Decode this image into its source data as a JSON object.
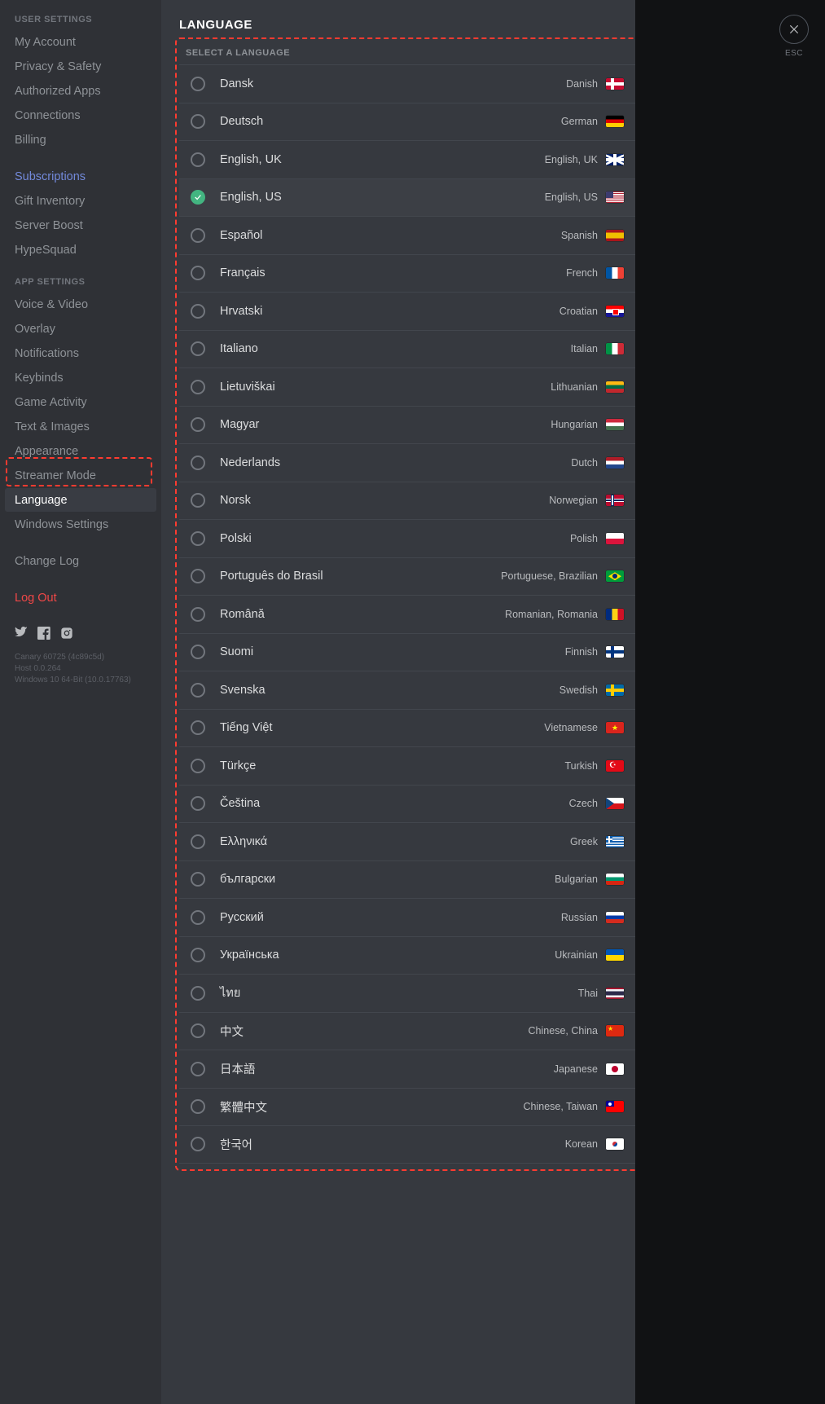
{
  "sidebar": {
    "user_settings_header": "USER SETTINGS",
    "user_items": [
      {
        "label": "My Account"
      },
      {
        "label": "Privacy & Safety"
      },
      {
        "label": "Authorized Apps"
      },
      {
        "label": "Connections"
      },
      {
        "label": "Billing"
      }
    ],
    "subs_item": "Subscriptions",
    "nitro_items": [
      {
        "label": "Gift Inventory"
      },
      {
        "label": "Server Boost"
      },
      {
        "label": "HypeSquad"
      }
    ],
    "app_settings_header": "APP SETTINGS",
    "app_items": [
      {
        "label": "Voice & Video"
      },
      {
        "label": "Overlay"
      },
      {
        "label": "Notifications"
      },
      {
        "label": "Keybinds"
      },
      {
        "label": "Game Activity"
      },
      {
        "label": "Text & Images"
      },
      {
        "label": "Appearance"
      },
      {
        "label": "Streamer Mode"
      },
      {
        "label": "Language",
        "selected": true
      },
      {
        "label": "Windows Settings"
      }
    ],
    "change_log": "Change Log",
    "logout": "Log Out",
    "build": {
      "line1": "Canary 60725 (4c89c5d)",
      "line2": "Host 0.0.264",
      "line3": "Windows 10 64-Bit (10.0.17763)"
    }
  },
  "main": {
    "title": "LANGUAGE",
    "panel_header": "SELECT A LANGUAGE",
    "languages": [
      {
        "native": "Dansk",
        "english": "Danish",
        "flag": "dk",
        "selected": false
      },
      {
        "native": "Deutsch",
        "english": "German",
        "flag": "de",
        "selected": false
      },
      {
        "native": "English, UK",
        "english": "English, UK",
        "flag": "gb",
        "selected": false
      },
      {
        "native": "English, US",
        "english": "English, US",
        "flag": "us",
        "selected": true
      },
      {
        "native": "Español",
        "english": "Spanish",
        "flag": "es",
        "selected": false
      },
      {
        "native": "Français",
        "english": "French",
        "flag": "fr",
        "selected": false
      },
      {
        "native": "Hrvatski",
        "english": "Croatian",
        "flag": "hr",
        "selected": false
      },
      {
        "native": "Italiano",
        "english": "Italian",
        "flag": "it",
        "selected": false
      },
      {
        "native": "Lietuviškai",
        "english": "Lithuanian",
        "flag": "lt",
        "selected": false
      },
      {
        "native": "Magyar",
        "english": "Hungarian",
        "flag": "hu",
        "selected": false
      },
      {
        "native": "Nederlands",
        "english": "Dutch",
        "flag": "nl",
        "selected": false
      },
      {
        "native": "Norsk",
        "english": "Norwegian",
        "flag": "no",
        "selected": false
      },
      {
        "native": "Polski",
        "english": "Polish",
        "flag": "pl",
        "selected": false
      },
      {
        "native": "Português do Brasil",
        "english": "Portuguese, Brazilian",
        "flag": "br",
        "selected": false
      },
      {
        "native": "Română",
        "english": "Romanian, Romania",
        "flag": "ro",
        "selected": false
      },
      {
        "native": "Suomi",
        "english": "Finnish",
        "flag": "fi",
        "selected": false
      },
      {
        "native": "Svenska",
        "english": "Swedish",
        "flag": "se",
        "selected": false
      },
      {
        "native": "Tiếng Việt",
        "english": "Vietnamese",
        "flag": "vn",
        "selected": false
      },
      {
        "native": "Türkçe",
        "english": "Turkish",
        "flag": "tr",
        "selected": false
      },
      {
        "native": "Čeština",
        "english": "Czech",
        "flag": "cz",
        "selected": false
      },
      {
        "native": "Ελληνικά",
        "english": "Greek",
        "flag": "gr",
        "selected": false
      },
      {
        "native": "български",
        "english": "Bulgarian",
        "flag": "bg",
        "selected": false
      },
      {
        "native": "Pусский",
        "english": "Russian",
        "flag": "ru",
        "selected": false
      },
      {
        "native": "Українська",
        "english": "Ukrainian",
        "flag": "ua",
        "selected": false
      },
      {
        "native": "ไทย",
        "english": "Thai",
        "flag": "th",
        "selected": false
      },
      {
        "native": "中文",
        "english": "Chinese, China",
        "flag": "cn",
        "selected": false
      },
      {
        "native": "日本語",
        "english": "Japanese",
        "flag": "jp",
        "selected": false
      },
      {
        "native": "繁體中文",
        "english": "Chinese, Taiwan",
        "flag": "tw",
        "selected": false
      },
      {
        "native": "한국어",
        "english": "Korean",
        "flag": "kr",
        "selected": false
      }
    ]
  },
  "close": {
    "esc_label": "ESC"
  }
}
